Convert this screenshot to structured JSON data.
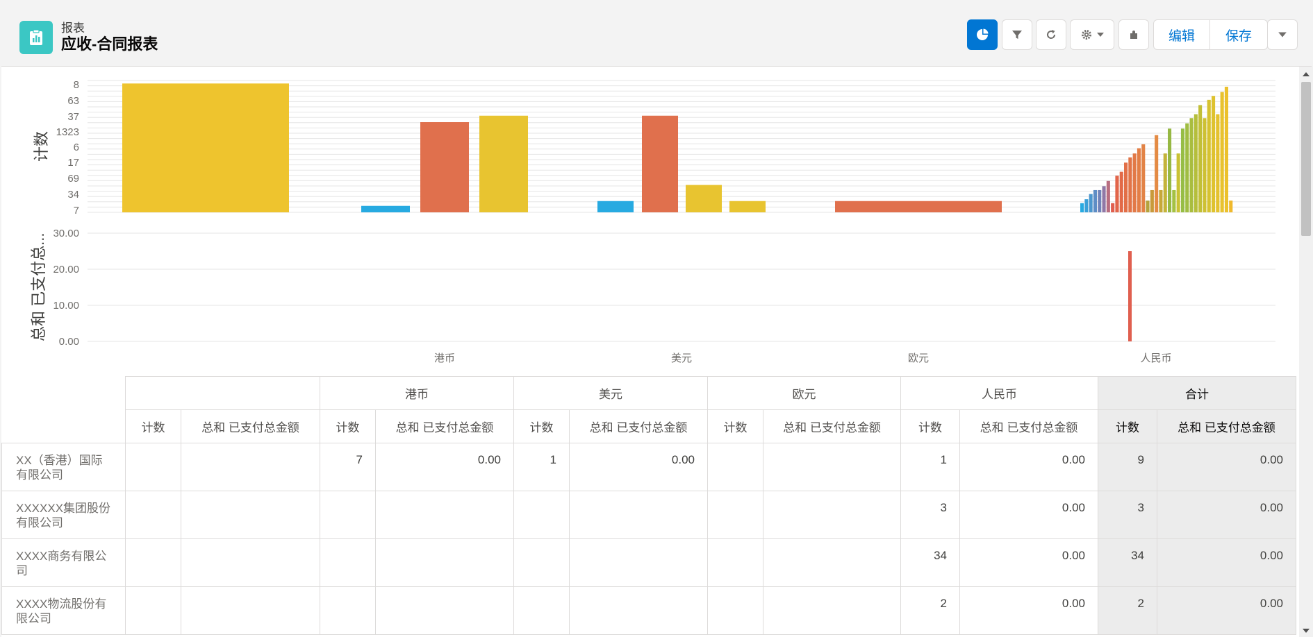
{
  "header": {
    "object_label": "报表",
    "title": "应收-合同报表",
    "icon": "report-icon",
    "buttons": {
      "chart": "chart-icon",
      "filter": "filter-icon",
      "refresh": "refresh-icon",
      "settings": "gear-icon",
      "addon": "puzzle-icon",
      "edit_label": "编辑",
      "save_label": "保存",
      "more": "chevron-down-icon"
    },
    "accent": "#0176d3"
  },
  "chart_data": [
    {
      "type": "bar",
      "ylabel": "计数",
      "yticks": [
        "7",
        "34",
        "69",
        "17",
        "6",
        "1323",
        "37",
        "63",
        "8"
      ],
      "categories": [
        "",
        "港币",
        "美元",
        "欧元",
        "人民币"
      ],
      "bars": [
        {
          "group": 0,
          "value": 8,
          "color": "#eec42e"
        },
        {
          "group": 1,
          "value": 0.4,
          "color": "#27aae1"
        },
        {
          "group": 1,
          "value": 5.6,
          "color": "#e0704d"
        },
        {
          "group": 1,
          "value": 6.0,
          "color": "#e8c430"
        },
        {
          "group": 2,
          "value": 0.7,
          "color": "#27aae1"
        },
        {
          "group": 2,
          "value": 6.0,
          "color": "#e0704d"
        },
        {
          "group": 2,
          "value": 1.7,
          "color": "#e8c430"
        },
        {
          "group": 2,
          "value": 0.7,
          "color": "#e8c430"
        },
        {
          "group": 3,
          "value": 0.7,
          "color": "#e0704d"
        }
      ],
      "rmb_bars": [
        0.7,
        1.0,
        1.4,
        1.7,
        1.7,
        2.0,
        2.4,
        0.7,
        2.8,
        3.1,
        3.8,
        4.2,
        4.5,
        4.9,
        5.2,
        0.9,
        1.7,
        5.9,
        1.7,
        4.5,
        6.4,
        1.7,
        4.5,
        6.4,
        6.8,
        7.2,
        7.5,
        8.2,
        7.2,
        8.6,
        8.9,
        7.5,
        9.2,
        9.6,
        0.9
      ],
      "rmb_colors": [
        "#27aae1",
        "#3aa0d8",
        "#4c97ce",
        "#5e8dc5",
        "#7183b9",
        "#9078a6",
        "#b86d80",
        "#e05f4f",
        "#e2654a",
        "#e26a48",
        "#e26f47",
        "#e27447",
        "#e27947",
        "#e37e46",
        "#e28346",
        "#b4a33d",
        "#c89a3a",
        "#e48b44",
        "#c6a83a",
        "#c4b43a",
        "#96b843",
        "#a4c143",
        "#c9c234",
        "#96bd45",
        "#a0bd42",
        "#a9bd3f",
        "#b5be3b",
        "#c2bf37",
        "#cdc033",
        "#d6c230",
        "#dec22f",
        "#e4c22e",
        "#e8c22e",
        "#ecc12d",
        "#f0b92d"
      ],
      "rmb_max": 9.6
    },
    {
      "type": "bar",
      "ylabel": "总和 已支付总...",
      "yticks": [
        "0.00",
        "10.00",
        "20.00",
        "30.00"
      ],
      "ylim": [
        0,
        30
      ],
      "categories": [
        "港币",
        "美元",
        "欧元",
        "人民币"
      ],
      "bars": [
        {
          "group": 4,
          "value": 25,
          "color": "#e05f4f"
        }
      ]
    }
  ],
  "table": {
    "group_headers": [
      "",
      "港币",
      "美元",
      "欧元",
      "人民币",
      "合计"
    ],
    "sub_headers": [
      "计数",
      "总和 已支付总金额",
      "计数",
      "总和 已支付总金额",
      "计数",
      "总和 已支付总金额",
      "计数",
      "总和 已支付总金额",
      "计数",
      "总和 已支付总金额",
      "计数",
      "总和 已支付总金额"
    ],
    "rows": [
      {
        "label": "XX（香港）国际有限公司",
        "cells": [
          "",
          "",
          "7",
          "0.00",
          "1",
          "0.00",
          "",
          "",
          "1",
          "0.00",
          "9",
          "0.00"
        ]
      },
      {
        "label": "XXXXXX集团股份有限公司",
        "cells": [
          "",
          "",
          "",
          "",
          "",
          "",
          "",
          "",
          "3",
          "0.00",
          "3",
          "0.00"
        ]
      },
      {
        "label": "XXXX商务有限公司",
        "cells": [
          "",
          "",
          "",
          "",
          "",
          "",
          "",
          "",
          "34",
          "0.00",
          "34",
          "0.00"
        ]
      },
      {
        "label": "XXXX物流股份有限公司",
        "cells": [
          "",
          "",
          "",
          "",
          "",
          "",
          "",
          "",
          "2",
          "0.00",
          "2",
          "0.00"
        ]
      }
    ]
  }
}
